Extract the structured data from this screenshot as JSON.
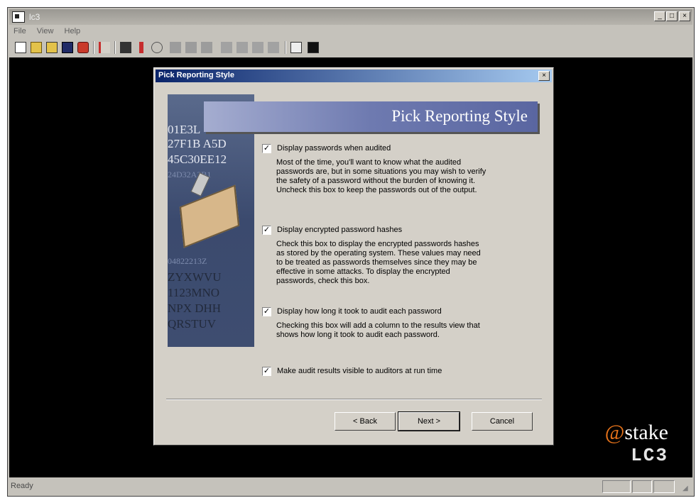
{
  "window": {
    "title": "lc3",
    "min_glyph": "_",
    "max_glyph": "□",
    "close_glyph": "×"
  },
  "menubar": {
    "items": [
      "File",
      "View",
      "Help"
    ]
  },
  "toolbar": {
    "icons": [
      "new-session-icon",
      "open-session-icon",
      "save-session-icon",
      "save-icon",
      "import-icon",
      "wizard-icon",
      "options-icon",
      "print-icon",
      "help-icon",
      "start-icon",
      "pause-icon",
      "stop-icon",
      "dictionary-icon",
      "hybrid-icon",
      "brute-force-icon",
      "schedule-icon",
      "report-icon",
      "stats-icon"
    ]
  },
  "status": {
    "text": "Ready"
  },
  "brand": {
    "at": "@",
    "name": "stake",
    "product": "LC3"
  },
  "dialog": {
    "title": "Pick Reporting Style",
    "close_glyph": "×",
    "banner": "Pick Reporting Style",
    "art_lines": [
      "01E3L",
      "27F1B A5D",
      "45C30EE12",
      "24D32A2B1",
      "04822213Z",
      "ZYXWVU",
      "1123MNO",
      "NPX DHH",
      "QRSTUV"
    ],
    "options": [
      {
        "checked": true,
        "label": "Display passwords when audited",
        "description": "Most of the time, you'll want to know what the audited passwords are, but in some situations you may wish to verify the safety of a password without the burden of knowing it. Uncheck this box to keep the passwords out of the output."
      },
      {
        "checked": true,
        "label": "Display encrypted password hashes",
        "description": "Check this box to display the encrypted passwords hashes as stored by the operating system. These values may need to be treated as passwords themselves since they may be effective in some attacks. To display the encrypted passwords, check this box."
      },
      {
        "checked": true,
        "label": "Display how long it took to audit each password",
        "description": "Checking this box will add a column to the results view that shows how long it took to audit each password."
      },
      {
        "checked": true,
        "label": "Make audit results visible to auditors at run time",
        "description": ""
      }
    ],
    "check_glyph": "✓",
    "buttons": {
      "back": "< Back",
      "next": "Next >",
      "cancel": "Cancel"
    }
  }
}
